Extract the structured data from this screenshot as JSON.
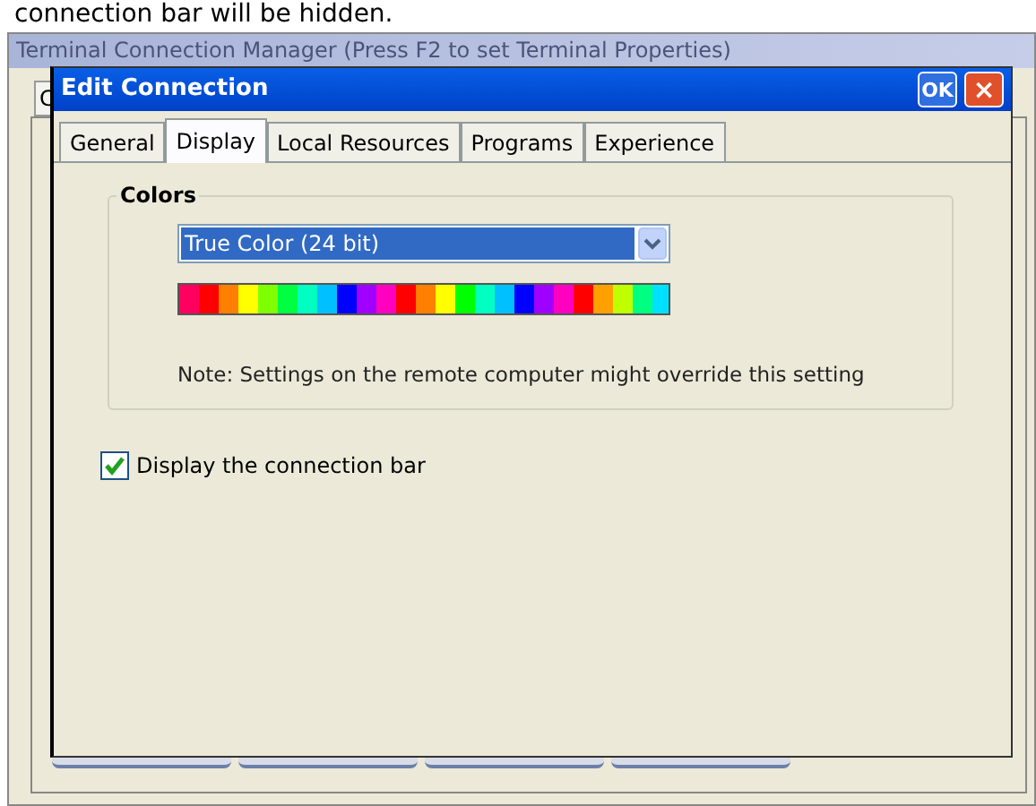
{
  "caption": "connection bar will be hidden.",
  "background_window": {
    "title": "Terminal Connection Manager (Press F2 to set Terminal Properties)",
    "tab_label": "C"
  },
  "dialog": {
    "title": "Edit Connection",
    "ok_button": "OK",
    "close_button": "×",
    "tabs": [
      {
        "label": "General",
        "selected": false
      },
      {
        "label": "Display",
        "selected": true
      },
      {
        "label": "Local Resources",
        "selected": false
      },
      {
        "label": "Programs",
        "selected": false
      },
      {
        "label": "Experience",
        "selected": false
      }
    ],
    "colors_group": {
      "title": "Colors",
      "dropdown_value": "True Color (24 bit)",
      "note": "Note: Settings on the remote computer might override this setting"
    },
    "connection_bar_checkbox": {
      "label": "Display the connection bar",
      "checked": true
    }
  }
}
